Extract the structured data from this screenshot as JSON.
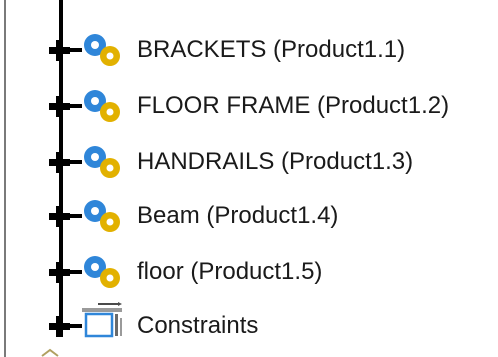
{
  "tree": {
    "items": [
      {
        "label": "BRACKETS (Product1.1)",
        "icon": "product-icon"
      },
      {
        "label": "FLOOR FRAME (Product1.2)",
        "icon": "product-icon"
      },
      {
        "label": "HANDRAILS (Product1.3)",
        "icon": "product-icon"
      },
      {
        "label": "Beam (Product1.4)",
        "icon": "product-icon"
      },
      {
        "label": "floor (Product1.5)",
        "icon": "product-icon"
      },
      {
        "label": "Constraints",
        "icon": "constraints-icon"
      }
    ]
  },
  "colors": {
    "gear_blue": "#2f86d9",
    "gear_gold": "#e2b100",
    "text": "#1a1a1a",
    "lines": "#000000"
  }
}
